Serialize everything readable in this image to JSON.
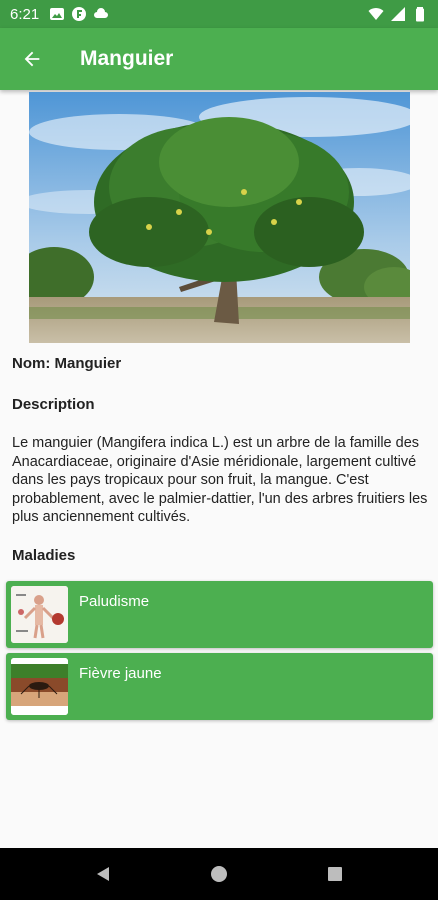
{
  "status_bar": {
    "time": "6:21",
    "left_icons": [
      "gallery-icon",
      "circle-app-icon",
      "cloud-icon"
    ],
    "right_icons": [
      "wifi-icon",
      "signal-icon",
      "battery-icon"
    ]
  },
  "app_bar": {
    "title": "Manguier",
    "back_icon": "arrow-back-icon",
    "color": "#4caf50"
  },
  "plant": {
    "name_line": "Nom: Manguier",
    "description_heading": "Description",
    "description": "Le manguier (Mangifera indica L.) est un arbre de la famille des Anacardiaceae, originaire d'Asie méridionale, largement cultivé dans les pays tropicaux pour son fruit, la mangue. C'est probablement, avec le palmier-dattier, l'un des arbres fruitiers les plus anciennement cultivés."
  },
  "maladies": {
    "heading": "Maladies",
    "items": [
      {
        "label": "Paludisme"
      },
      {
        "label": "Fièvre jaune"
      }
    ]
  },
  "nav_bar": {
    "buttons": [
      "back-triangle-icon",
      "home-circle-icon",
      "recents-square-icon"
    ]
  }
}
